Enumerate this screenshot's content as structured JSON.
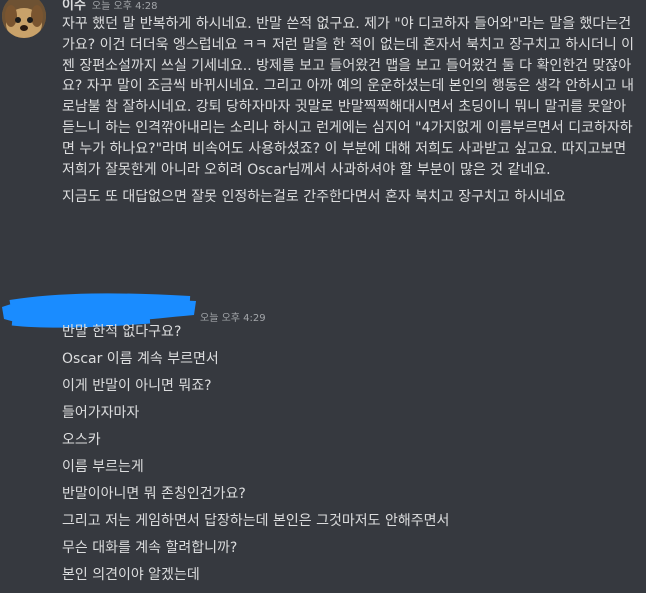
{
  "message1": {
    "username": "이수",
    "timestamp": "오늘 오후 4:28",
    "paragraph1": "자꾸 했던 말 반복하게 하시네요. 반말 쓴적 없구요. 제가 \"야 디코하자 들어와\"라는 말을 했다는건가요? 이건 더더욱 엥스럽네요 ㅋㅋ 저런 말을 한 적이 없는데 혼자서 북치고 장구치고 하시더니 이젠 장편소설까지 쓰실 기세네요.. 방제를 보고 들어왔건 맵을 보고 들어왔건 둘 다 확인한건 맞잖아요? 자꾸 말이 조금씩 바뀌시네요. 그리고 아까 예의 운운하셨는데 본인의 행동은 생각 안하시고 내로남불 참 잘하시네요. 강퇴 당하자마자 귓말로 반말찍찍해대시면서 초딩이니 뭐니 말귀를 못알아 듣느니 하는 인격깎아내리는 소리나 하시고 런게에는 심지어 \"4가지없게 이름부르면서 디코하자하면 누가 하나요?\"라며 비속어도 사용하셨죠? 이 부분에 대해 저희도 사과받고 싶고요. 따지고보면 저희가 잘못한게 아니라 오히려 Oscar님께서 사과하셔야 할 부분이 많은 것 같네요.",
    "paragraph2": "지금도 또 대답없으면 잘못 인정하는걸로 간주한다면서 혼자 북치고 장구치고 하시네요"
  },
  "message2": {
    "timestamp": "오늘 오후 4:29",
    "lines": [
      "반말 한적 없다구요?",
      "Oscar 이름 계속 부르면서",
      "이게 반말이 아니면 뭐죠?",
      "들어가자마자",
      "오스카",
      "이름 부르는게",
      "반말이아니면 뭐 존칭인건가요?",
      "그리고 저는 게임하면서 답장하는데 본인은 그것마저도 안해주면서",
      "무슨 대화를 계속 할려합니까?",
      "본인 의견이야 알겠는데"
    ]
  },
  "colors": {
    "background": "#36393f",
    "text": "#dcddde",
    "timestamp": "#a3a6aa",
    "redaction": "#1a8cff"
  }
}
